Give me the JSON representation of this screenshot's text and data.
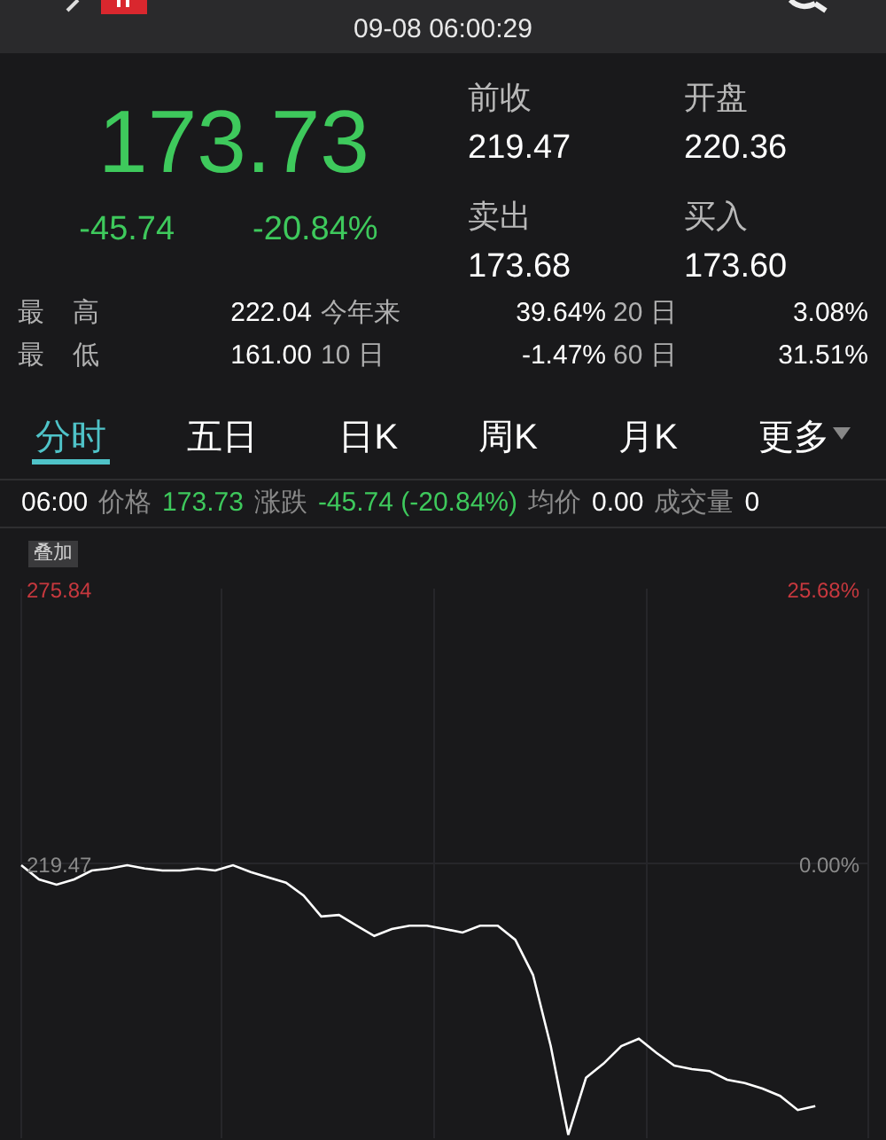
{
  "header": {
    "datetime": "09-08 06:00:29"
  },
  "quote": {
    "price": "173.73",
    "change": "-45.74",
    "change_percent": "-20.84%",
    "fields": [
      {
        "label": "前收",
        "value": "219.47"
      },
      {
        "label": "开盘",
        "value": "220.36"
      },
      {
        "label": "卖出",
        "value": "173.68"
      },
      {
        "label": "买入",
        "value": "173.60"
      }
    ]
  },
  "stats": [
    {
      "label": "最 高",
      "value": "222.04",
      "period_1": "今年来",
      "value_1": "39.64%",
      "period_2": "20 日",
      "value_2": "3.08%"
    },
    {
      "label": "最 低",
      "value": "161.00",
      "period_1": "10 日",
      "value_1": "-1.47%",
      "period_2": "60 日",
      "value_2": "31.51%"
    }
  ],
  "tabs": [
    {
      "label": "分时",
      "selected": true
    },
    {
      "label": "五日",
      "selected": false
    },
    {
      "label": "日K",
      "selected": false
    },
    {
      "label": "周K",
      "selected": false
    },
    {
      "label": "月K",
      "selected": false
    },
    {
      "label": "更多",
      "selected": false,
      "dropdown": true
    }
  ],
  "info_line": [
    {
      "kind": "time",
      "text": "06:00"
    },
    {
      "kind": "label",
      "text": "价格"
    },
    {
      "kind": "down",
      "text": "173.73"
    },
    {
      "kind": "label",
      "text": "涨跌"
    },
    {
      "kind": "down",
      "text": "-45.74 (-20.84%)"
    },
    {
      "kind": "label",
      "text": "均价"
    },
    {
      "kind": "value",
      "text": "0.00"
    },
    {
      "kind": "label",
      "text": "成交量"
    },
    {
      "kind": "value",
      "text": "0"
    }
  ],
  "chart": {
    "overlay_button": "叠加",
    "percent_labels": [
      "25.68%",
      "0.00%"
    ],
    "chart_data": {
      "type": "line",
      "ylim": [
        163.1,
        275.84
      ],
      "yticks": [
        {
          "value": 275.84,
          "label": "275.84"
        },
        {
          "value": 219.47,
          "label": "219.47"
        }
      ],
      "series": [
        {
          "color": "#ffffff",
          "values": [
            219.1,
            216.2,
            215.1,
            216.2,
            218.0,
            218.4,
            219.1,
            218.4,
            218.0,
            218.0,
            218.4,
            218.0,
            219.1,
            217.7,
            216.6,
            215.5,
            212.9,
            208.6,
            208.9,
            206.7,
            204.6,
            206.0,
            206.7,
            206.7,
            206.0,
            205.3,
            206.7,
            206.7,
            203.8,
            196.6,
            182.0,
            163.8,
            175.5,
            178.4,
            182.0,
            183.5,
            180.6,
            178.0,
            177.3,
            176.9,
            175.1,
            174.4,
            173.3,
            171.8,
            168.9,
            169.7
          ]
        }
      ]
    }
  }
}
